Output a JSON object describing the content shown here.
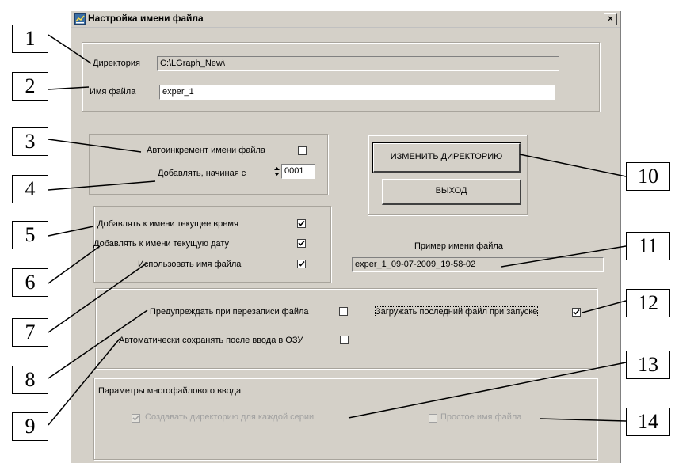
{
  "window": {
    "title": "Настройка имени файла",
    "close_label": "×",
    "icon": "app-icon"
  },
  "directory_section": {
    "dir_label": "Директория",
    "dir_value": "C:\\LGraph_New\\",
    "name_label": "Имя файла",
    "name_value": "exper_1"
  },
  "increment_section": {
    "auto_label": "Автоинкремент имени файла",
    "auto_checked": false,
    "start_label": "Добавлять, начиная с",
    "start_value": "0001"
  },
  "buttons": {
    "change_dir": "ИЗМЕНИТЬ ДИРЕКТОРИЮ",
    "exit": "ВЫХОД"
  },
  "append_section": {
    "time_label": "Добавлять к имени текущее время",
    "time_checked": true,
    "date_label": "Добавлять к имени  текущую дату",
    "date_checked": true,
    "use_name_label": "Использовать имя файла",
    "use_name_checked": true
  },
  "example": {
    "label": "Пример имени файла",
    "value": "exper_1_09-07-2009_19-58-02"
  },
  "options_section": {
    "warn_label": "Предупреждать при перезаписи файла",
    "warn_checked": false,
    "autosave_label": "Автоматически сохранять после ввода в ОЗУ",
    "autosave_checked": false,
    "load_last_label": "Загружать последний файл при запуске",
    "load_last_checked": true
  },
  "multifile_section": {
    "title": "Параметры многофайлового ввода",
    "create_dir_label": "Создавать директорию для каждой серии",
    "create_dir_checked": true,
    "simple_name_label": "Простое имя файла",
    "simple_name_checked": false
  },
  "callouts": [
    "1",
    "2",
    "3",
    "4",
    "5",
    "6",
    "7",
    "8",
    "9",
    "10",
    "11",
    "12",
    "13",
    "14"
  ]
}
